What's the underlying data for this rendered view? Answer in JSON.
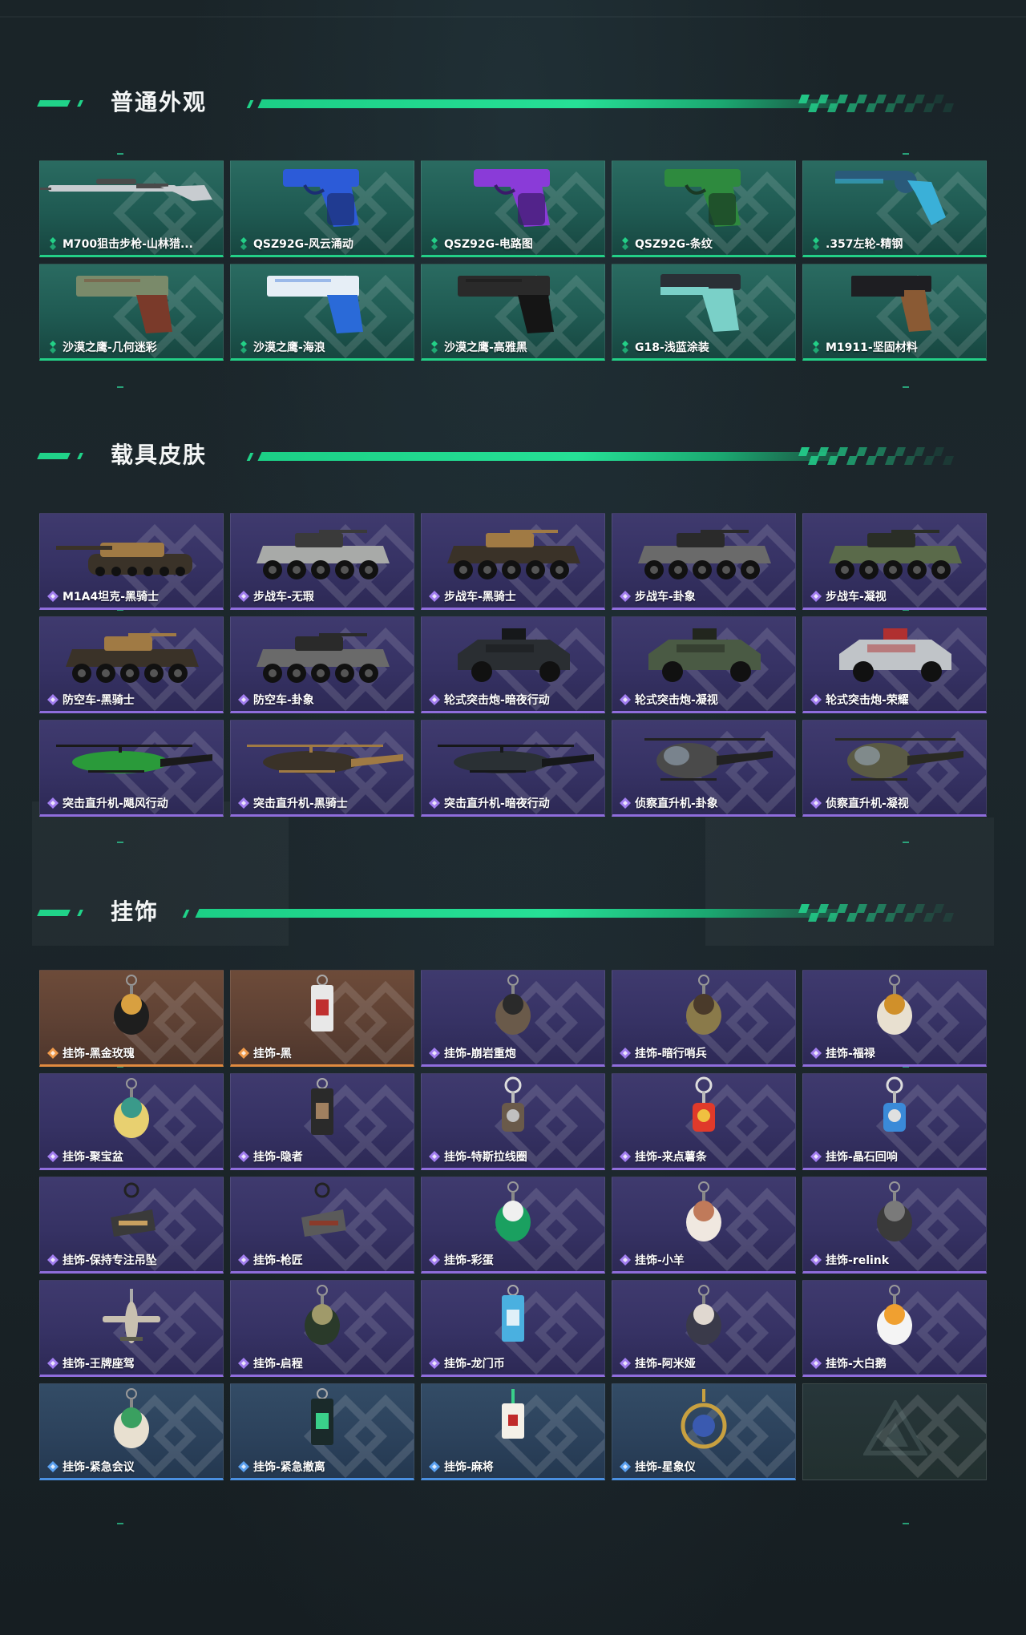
{
  "sections": [
    {
      "title": "普通外观",
      "items": [
        {
          "label": "M700狙击步枪-山林猎...",
          "kind": "rifle",
          "colors": [
            "#c8ccd0",
            "#4a4a4a"
          ]
        },
        {
          "label": "QSZ92G-风云涌动",
          "kind": "pistol",
          "colors": [
            "#2c5bd8",
            "#1b2e74"
          ]
        },
        {
          "label": "QSZ92G-电路图",
          "kind": "pistol",
          "colors": [
            "#8a3bd8",
            "#3a1a6a"
          ]
        },
        {
          "label": "QSZ92G-条纹",
          "kind": "pistol",
          "colors": [
            "#2e8a3e",
            "#1a3a24"
          ]
        },
        {
          "label": ".357左轮-精钢",
          "kind": "revolver",
          "colors": [
            "#2a5a7a",
            "#3ab0d8"
          ]
        },
        {
          "label": "沙漠之鹰-几何迷彩",
          "kind": "deagle",
          "colors": [
            "#7a8a6a",
            "#7a3a2a"
          ]
        },
        {
          "label": "沙漠之鹰-海浪",
          "kind": "deagle",
          "colors": [
            "#e6eef6",
            "#2a6ad8"
          ]
        },
        {
          "label": "沙漠之鹰-高雅黑",
          "kind": "deagle",
          "colors": [
            "#2a2a2a",
            "#151515"
          ]
        },
        {
          "label": "G18-浅蓝涂装",
          "kind": "glock",
          "colors": [
            "#2a3036",
            "#7ad0c8"
          ]
        },
        {
          "label": "M1911-坚固材料",
          "kind": "m1911",
          "colors": [
            "#1e1e22",
            "#8a5a34"
          ]
        }
      ]
    },
    {
      "title": "载具皮肤",
      "items": [
        {
          "label": "M1A4坦克-黑骑士",
          "kind": "tank",
          "colors": [
            "#3a3228",
            "#a07a44"
          ]
        },
        {
          "label": "步战车-无瑕",
          "kind": "ifv",
          "colors": [
            "#a8aaa8",
            "#3a3a3a"
          ]
        },
        {
          "label": "步战车-黑骑士",
          "kind": "ifv",
          "colors": [
            "#3a3228",
            "#a07a44"
          ]
        },
        {
          "label": "步战车-卦象",
          "kind": "ifv",
          "colors": [
            "#6a6a6a",
            "#2a2a2a"
          ]
        },
        {
          "label": "步战车-凝视",
          "kind": "ifv",
          "colors": [
            "#5a6a4a",
            "#2a2e26"
          ]
        },
        {
          "label": "防空车-黑骑士",
          "kind": "ifv",
          "colors": [
            "#3a3228",
            "#a07a44"
          ]
        },
        {
          "label": "防空车-卦象",
          "kind": "ifv",
          "colors": [
            "#6a6a6a",
            "#2a2a2a"
          ]
        },
        {
          "label": "轮式突击炮-暗夜行动",
          "kind": "car",
          "colors": [
            "#2a2e32",
            "#16181a"
          ]
        },
        {
          "label": "轮式突击炮-凝视",
          "kind": "car",
          "colors": [
            "#4a5a44",
            "#22261e"
          ]
        },
        {
          "label": "轮式突击炮-荣耀",
          "kind": "car",
          "colors": [
            "#c0c4c8",
            "#b03030"
          ]
        },
        {
          "label": "突击直升机-飓风行动",
          "kind": "heli",
          "colors": [
            "#2a9a3a",
            "#1a1a1a"
          ]
        },
        {
          "label": "突击直升机-黑骑士",
          "kind": "heli",
          "colors": [
            "#3a3228",
            "#a07a44"
          ]
        },
        {
          "label": "突击直升机-暗夜行动",
          "kind": "heli",
          "colors": [
            "#2a3034",
            "#16181a"
          ]
        },
        {
          "label": "侦察直升机-卦象",
          "kind": "scout",
          "colors": [
            "#4a4a4a",
            "#222222"
          ]
        },
        {
          "label": "侦察直升机-凝视",
          "kind": "scout",
          "colors": [
            "#5a5a44",
            "#2a2a22"
          ]
        }
      ]
    },
    {
      "title": "挂饰",
      "items": [
        {
          "label": "挂饰-黑金玫瑰",
          "kind": "charm",
          "rarity": "orange",
          "colors": [
            "#1e1e1e",
            "#d8a040"
          ]
        },
        {
          "label": "挂饰-黑",
          "kind": "charm-card",
          "rarity": "orange",
          "colors": [
            "#e8e8e8",
            "#c03030"
          ]
        },
        {
          "label": "挂饰-崩岩重炮",
          "kind": "charm",
          "rarity": "purple",
          "colors": [
            "#6a5a4a",
            "#2a2a2a"
          ]
        },
        {
          "label": "挂饰-暗行哨兵",
          "kind": "charm",
          "rarity": "purple",
          "colors": [
            "#8a7a4a",
            "#4a3a2a"
          ]
        },
        {
          "label": "挂饰-福禄",
          "kind": "charm",
          "rarity": "purple",
          "colors": [
            "#e8e0d0",
            "#d0902a"
          ]
        },
        {
          "label": "挂饰-聚宝盆",
          "kind": "charm",
          "rarity": "purple",
          "colors": [
            "#e8d070",
            "#3a9a8a"
          ]
        },
        {
          "label": "挂饰-隐者",
          "kind": "charm-card",
          "rarity": "purple",
          "colors": [
            "#2a2a2a",
            "#a08060"
          ]
        },
        {
          "label": "挂饰-特斯拉线圈",
          "kind": "charm-ring",
          "rarity": "purple",
          "colors": [
            "#6a5a4a",
            "#c0c0c0"
          ]
        },
        {
          "label": "挂饰-来点薯条",
          "kind": "charm-ring",
          "rarity": "purple",
          "colors": [
            "#e03a2a",
            "#f0c040"
          ]
        },
        {
          "label": "挂饰-晶石回响",
          "kind": "charm-ring",
          "rarity": "purple",
          "colors": [
            "#3a8ad8",
            "#e0e0e0"
          ]
        },
        {
          "label": "挂饰-保持专注吊坠",
          "kind": "charm-tag",
          "rarity": "purple",
          "colors": [
            "#3a3a3a",
            "#c8a060"
          ]
        },
        {
          "label": "挂饰-枪匠",
          "kind": "charm-tag",
          "rarity": "purple",
          "colors": [
            "#5a5a5a",
            "#8a3a2a"
          ]
        },
        {
          "label": "挂饰-彩蛋",
          "kind": "charm",
          "rarity": "purple",
          "colors": [
            "#1aa060",
            "#f0f0f0"
          ]
        },
        {
          "label": "挂饰-小羊",
          "kind": "charm",
          "rarity": "purple",
          "colors": [
            "#f0e8e0",
            "#c07a5a"
          ]
        },
        {
          "label": "挂饰-relink",
          "kind": "charm",
          "rarity": "purple",
          "colors": [
            "#3a3a3a",
            "#7a7a7a"
          ]
        },
        {
          "label": "挂饰-王牌座驾",
          "kind": "charm-plane",
          "rarity": "purple",
          "colors": [
            "#c8c0b0",
            "#5a5a4a"
          ]
        },
        {
          "label": "挂饰-启程",
          "kind": "charm",
          "rarity": "purple",
          "colors": [
            "#2a3a2a",
            "#a09a6a"
          ]
        },
        {
          "label": "挂饰-龙门币",
          "kind": "charm-card",
          "rarity": "purple",
          "colors": [
            "#4ab0e0",
            "#e0f0f8"
          ]
        },
        {
          "label": "挂饰-阿米娅",
          "kind": "charm",
          "rarity": "purple",
          "colors": [
            "#3a3a4a",
            "#e0d8d0"
          ]
        },
        {
          "label": "挂饰-大白鹅",
          "kind": "charm",
          "rarity": "purple",
          "colors": [
            "#f4f4f4",
            "#f0a030"
          ]
        },
        {
          "label": "挂饰-紧急会议",
          "kind": "charm",
          "rarity": "blue",
          "colors": [
            "#e8e0d0",
            "#3aa060"
          ]
        },
        {
          "label": "挂饰-紧急撤离",
          "kind": "charm-card",
          "rarity": "blue",
          "colors": [
            "#1a2a2a",
            "#3ad08a"
          ]
        },
        {
          "label": "挂饰-麻将",
          "kind": "charm-mahjong",
          "rarity": "blue",
          "colors": [
            "#f4f0e8",
            "#c02a2a"
          ]
        },
        {
          "label": "挂饰-星象仪",
          "kind": "charm-orb",
          "rarity": "blue",
          "colors": [
            "#c8a040",
            "#3a5ab0"
          ]
        },
        {
          "label": "",
          "kind": "empty",
          "rarity": "empty",
          "colors": [
            "#3a4a4a",
            "#3a4a4a"
          ]
        }
      ]
    }
  ],
  "theme": {
    "accent_green": "#20d389",
    "weapon_rarity": "#23d087",
    "purple_rarity": "#8f6ddc",
    "orange_rarity": "#e08a3f",
    "blue_rarity": "#4a8fe0"
  }
}
